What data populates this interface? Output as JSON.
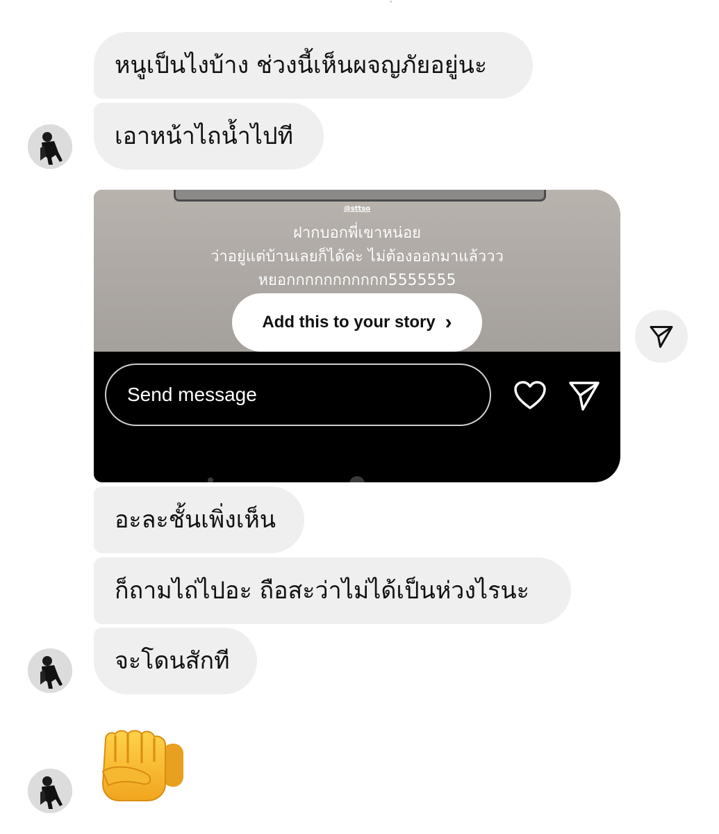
{
  "messages": [
    {
      "text": "หนูเป็นไงบ้าง ช่วงนี้เห็นผจญภัยอยู่นะ"
    },
    {
      "text": "เอาหน้าไถน้ำไปที"
    },
    {
      "text": "อะละชั้นเพิ่งเห็น"
    },
    {
      "text": "ก็ถามไถ่ไปอะ ถือสะว่าไม่ได้เป็นห่วงไรนะ"
    },
    {
      "text": "จะโดนสักที"
    }
  ],
  "shared_story": {
    "handle": "@sttso",
    "caption_lines": [
      "ฝากบอกพี่เขาหน่อย",
      "ว่าอยู่แต่บ้านเลยก็ได้ค่ะ ไม่ต้องออกมาแล้ววว",
      "หยอกกกกกกกกกกก5555555"
    ],
    "add_story_label": "Add this to your story",
    "send_message_placeholder": "Send message"
  },
  "reaction_emoji": "fist-bump-emoji",
  "icons": {
    "heart": "heart-icon",
    "send": "send-icon",
    "share": "share-icon",
    "chevron": "chevron-right-icon"
  },
  "colors": {
    "bubble_bg": "#efefef",
    "text": "#111111",
    "story_bg": "#000000"
  }
}
